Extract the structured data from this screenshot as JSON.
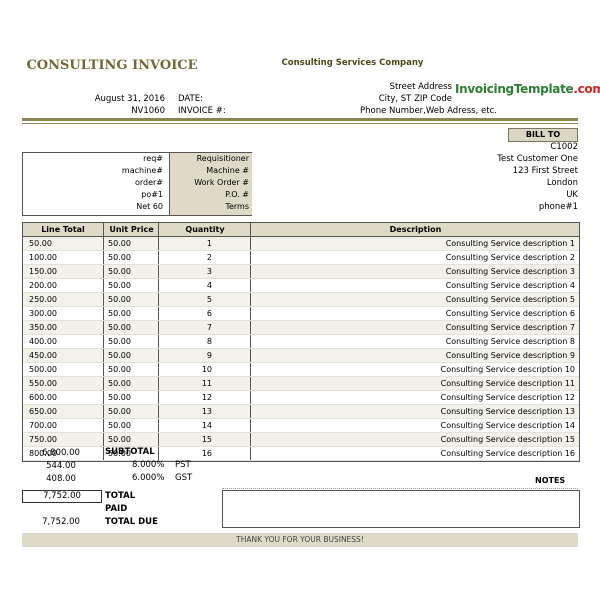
{
  "header": {
    "title": "CONSULTING INVOICE",
    "company": "Consulting Services Company",
    "logo_main": "InvoicingTemplate",
    "logo_suffix": ".com"
  },
  "address": {
    "street": "Street Address",
    "city": "City, ST ZIP Code",
    "contact": "Phone Number,Web Adress, etc."
  },
  "meta": {
    "date_label": "DATE:",
    "date_value": "August 31, 2016",
    "invoice_label": "INVOICE #:",
    "invoice_value": "NV1060"
  },
  "bill_to": {
    "label": "BILL TO",
    "lines": [
      "C1002",
      "Test Customer One",
      "123 First Street",
      "London",
      "UK",
      "phone#1"
    ]
  },
  "reference": [
    {
      "label": "Requisitioner",
      "value": "req#"
    },
    {
      "label": "Machine #",
      "value": "machine#"
    },
    {
      "label": "Work Order #",
      "value": "order#"
    },
    {
      "label": "P.O. #",
      "value": "po#1"
    },
    {
      "label": "Terms",
      "value": "Net 60"
    }
  ],
  "table": {
    "headers": {
      "total": "Line Total",
      "unit": "Unit Price",
      "qty": "Quantity",
      "desc": "Description"
    },
    "rows": [
      {
        "desc": "Consulting Service description 1",
        "qty": "1",
        "unit": "50.00",
        "total": "50.00"
      },
      {
        "desc": "Consulting Service description 2",
        "qty": "2",
        "unit": "50.00",
        "total": "100.00"
      },
      {
        "desc": "Consulting Service description 3",
        "qty": "3",
        "unit": "50.00",
        "total": "150.00"
      },
      {
        "desc": "Consulting Service description 4",
        "qty": "4",
        "unit": "50.00",
        "total": "200.00"
      },
      {
        "desc": "Consulting Service description 5",
        "qty": "5",
        "unit": "50.00",
        "total": "250.00"
      },
      {
        "desc": "Consulting Service description 6",
        "qty": "6",
        "unit": "50.00",
        "total": "300.00"
      },
      {
        "desc": "Consulting Service description 7",
        "qty": "7",
        "unit": "50.00",
        "total": "350.00"
      },
      {
        "desc": "Consulting Service description 8",
        "qty": "8",
        "unit": "50.00",
        "total": "400.00"
      },
      {
        "desc": "Consulting Service description 9",
        "qty": "9",
        "unit": "50.00",
        "total": "450.00"
      },
      {
        "desc": "Consulting Service description 10",
        "qty": "10",
        "unit": "50.00",
        "total": "500.00"
      },
      {
        "desc": "Consulting Service description 11",
        "qty": "11",
        "unit": "50.00",
        "total": "550.00"
      },
      {
        "desc": "Consulting Service description 12",
        "qty": "12",
        "unit": "50.00",
        "total": "600.00"
      },
      {
        "desc": "Consulting Service description 13",
        "qty": "13",
        "unit": "50.00",
        "total": "650.00"
      },
      {
        "desc": "Consulting Service description 14",
        "qty": "14",
        "unit": "50.00",
        "total": "700.00"
      },
      {
        "desc": "Consulting Service description 15",
        "qty": "15",
        "unit": "50.00",
        "total": "750.00"
      },
      {
        "desc": "Consulting Service description 16",
        "qty": "16",
        "unit": "50.00",
        "total": "800.00"
      }
    ]
  },
  "summary": {
    "subtotal_label": "SUBTOTAL",
    "subtotal_value": "6,800.00",
    "pst_label": "PST",
    "pst_rate": "8.000%",
    "pst_value": "544.00",
    "gst_label": "GST",
    "gst_rate": "6.000%",
    "gst_value": "408.00",
    "total_label": "TOTAL",
    "total_value": "7,752.00",
    "paid_label": "PAID",
    "paid_value": "",
    "due_label": "TOTAL DUE",
    "due_value": "7,752.00"
  },
  "notes_label": "NOTES",
  "footer": {
    "thanks": "THANK YOU FOR YOUR BUSINESS!"
  },
  "colors": {
    "accent": "#6f6a34",
    "header_fill": "#dddac8",
    "logo_green": "#2e7d32",
    "logo_red": "#c62828"
  }
}
